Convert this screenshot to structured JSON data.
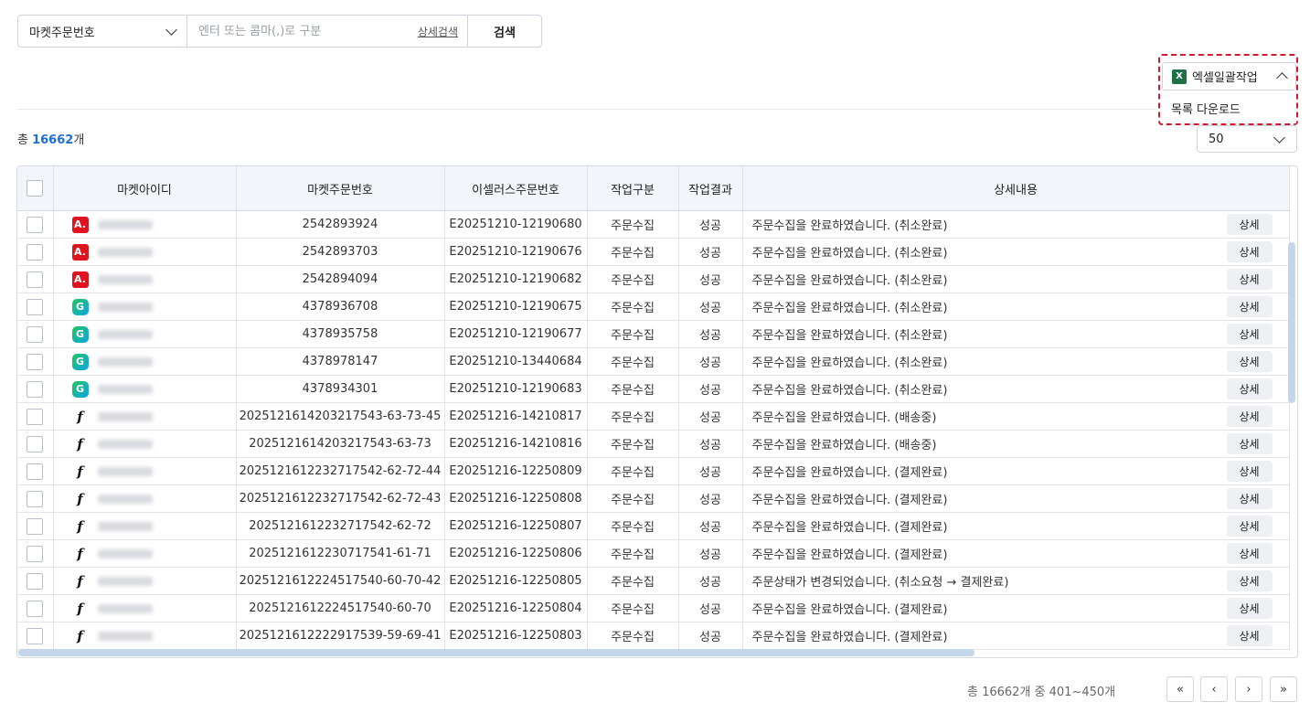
{
  "search": {
    "select_value": "마켓주문번호",
    "placeholder": "엔터 또는 콤마(,)로 구분",
    "advanced_label": "상세검색",
    "button_label": "검색"
  },
  "excel": {
    "button_label": "엑셀일괄작업",
    "icon_letter": "X",
    "menu_item": "목록 다운로드"
  },
  "summary": {
    "prefix": "총 ",
    "count": "16662",
    "suffix": "개"
  },
  "page_size": "50",
  "table": {
    "headers": [
      "마켓아이디",
      "마켓주문번호",
      "이셀러스주문번호",
      "작업구분",
      "작업결과",
      "상세내용"
    ],
    "detail_button": "상세",
    "rows": [
      {
        "icon": "a",
        "market_order": "2542893924",
        "esellers_order": "E20251210-12190680",
        "task": "주문수집",
        "result": "성공",
        "detail": "주문수집을 완료하였습니다. (취소완료)"
      },
      {
        "icon": "a",
        "market_order": "2542893703",
        "esellers_order": "E20251210-12190676",
        "task": "주문수집",
        "result": "성공",
        "detail": "주문수집을 완료하였습니다. (취소완료)"
      },
      {
        "icon": "a",
        "market_order": "2542894094",
        "esellers_order": "E20251210-12190682",
        "task": "주문수집",
        "result": "성공",
        "detail": "주문수집을 완료하였습니다. (취소완료)"
      },
      {
        "icon": "g",
        "market_order": "4378936708",
        "esellers_order": "E20251210-12190675",
        "task": "주문수집",
        "result": "성공",
        "detail": "주문수집을 완료하였습니다. (취소완료)"
      },
      {
        "icon": "g",
        "market_order": "4378935758",
        "esellers_order": "E20251210-12190677",
        "task": "주문수집",
        "result": "성공",
        "detail": "주문수집을 완료하였습니다. (취소완료)"
      },
      {
        "icon": "g",
        "market_order": "4378978147",
        "esellers_order": "E20251210-13440684",
        "task": "주문수집",
        "result": "성공",
        "detail": "주문수집을 완료하였습니다. (취소완료)"
      },
      {
        "icon": "g",
        "market_order": "4378934301",
        "esellers_order": "E20251210-12190683",
        "task": "주문수집",
        "result": "성공",
        "detail": "주문수집을 완료하였습니다. (취소완료)"
      },
      {
        "icon": "f",
        "market_order": "2025121614203217543-63-73-45",
        "esellers_order": "E20251216-14210817",
        "task": "주문수집",
        "result": "성공",
        "detail": "주문수집을 완료하였습니다. (배송중)"
      },
      {
        "icon": "f",
        "market_order": "2025121614203217543-63-73",
        "esellers_order": "E20251216-14210816",
        "task": "주문수집",
        "result": "성공",
        "detail": "주문수집을 완료하였습니다. (배송중)"
      },
      {
        "icon": "f",
        "market_order": "2025121612232717542-62-72-44",
        "esellers_order": "E20251216-12250809",
        "task": "주문수집",
        "result": "성공",
        "detail": "주문수집을 완료하였습니다. (결제완료)"
      },
      {
        "icon": "f",
        "market_order": "2025121612232717542-62-72-43",
        "esellers_order": "E20251216-12250808",
        "task": "주문수집",
        "result": "성공",
        "detail": "주문수집을 완료하였습니다. (결제완료)"
      },
      {
        "icon": "f",
        "market_order": "2025121612232717542-62-72",
        "esellers_order": "E20251216-12250807",
        "task": "주문수집",
        "result": "성공",
        "detail": "주문수집을 완료하였습니다. (결제완료)"
      },
      {
        "icon": "f",
        "market_order": "2025121612230717541-61-71",
        "esellers_order": "E20251216-12250806",
        "task": "주문수집",
        "result": "성공",
        "detail": "주문수집을 완료하였습니다. (결제완료)"
      },
      {
        "icon": "f",
        "market_order": "2025121612224517540-60-70-42",
        "esellers_order": "E20251216-12250805",
        "task": "주문수집",
        "result": "성공",
        "detail": "주문상태가 변경되었습니다. (취소요청 → 결제완료)"
      },
      {
        "icon": "f",
        "market_order": "2025121612224517540-60-70",
        "esellers_order": "E20251216-12250804",
        "task": "주문수집",
        "result": "성공",
        "detail": "주문수집을 완료하였습니다. (결제완료)"
      },
      {
        "icon": "f",
        "market_order": "2025121612222917539-59-69-41",
        "esellers_order": "E20251216-12250803",
        "task": "주문수집",
        "result": "성공",
        "detail": "주문수집을 완료하였습니다. (결제완료)"
      }
    ]
  },
  "pagination": {
    "info": "총 16662개 중 401~450개",
    "first": "«",
    "prev": "‹",
    "next": "›",
    "last": "»"
  },
  "icon_letters": {
    "a": "A.",
    "g": "G",
    "f": "f"
  }
}
